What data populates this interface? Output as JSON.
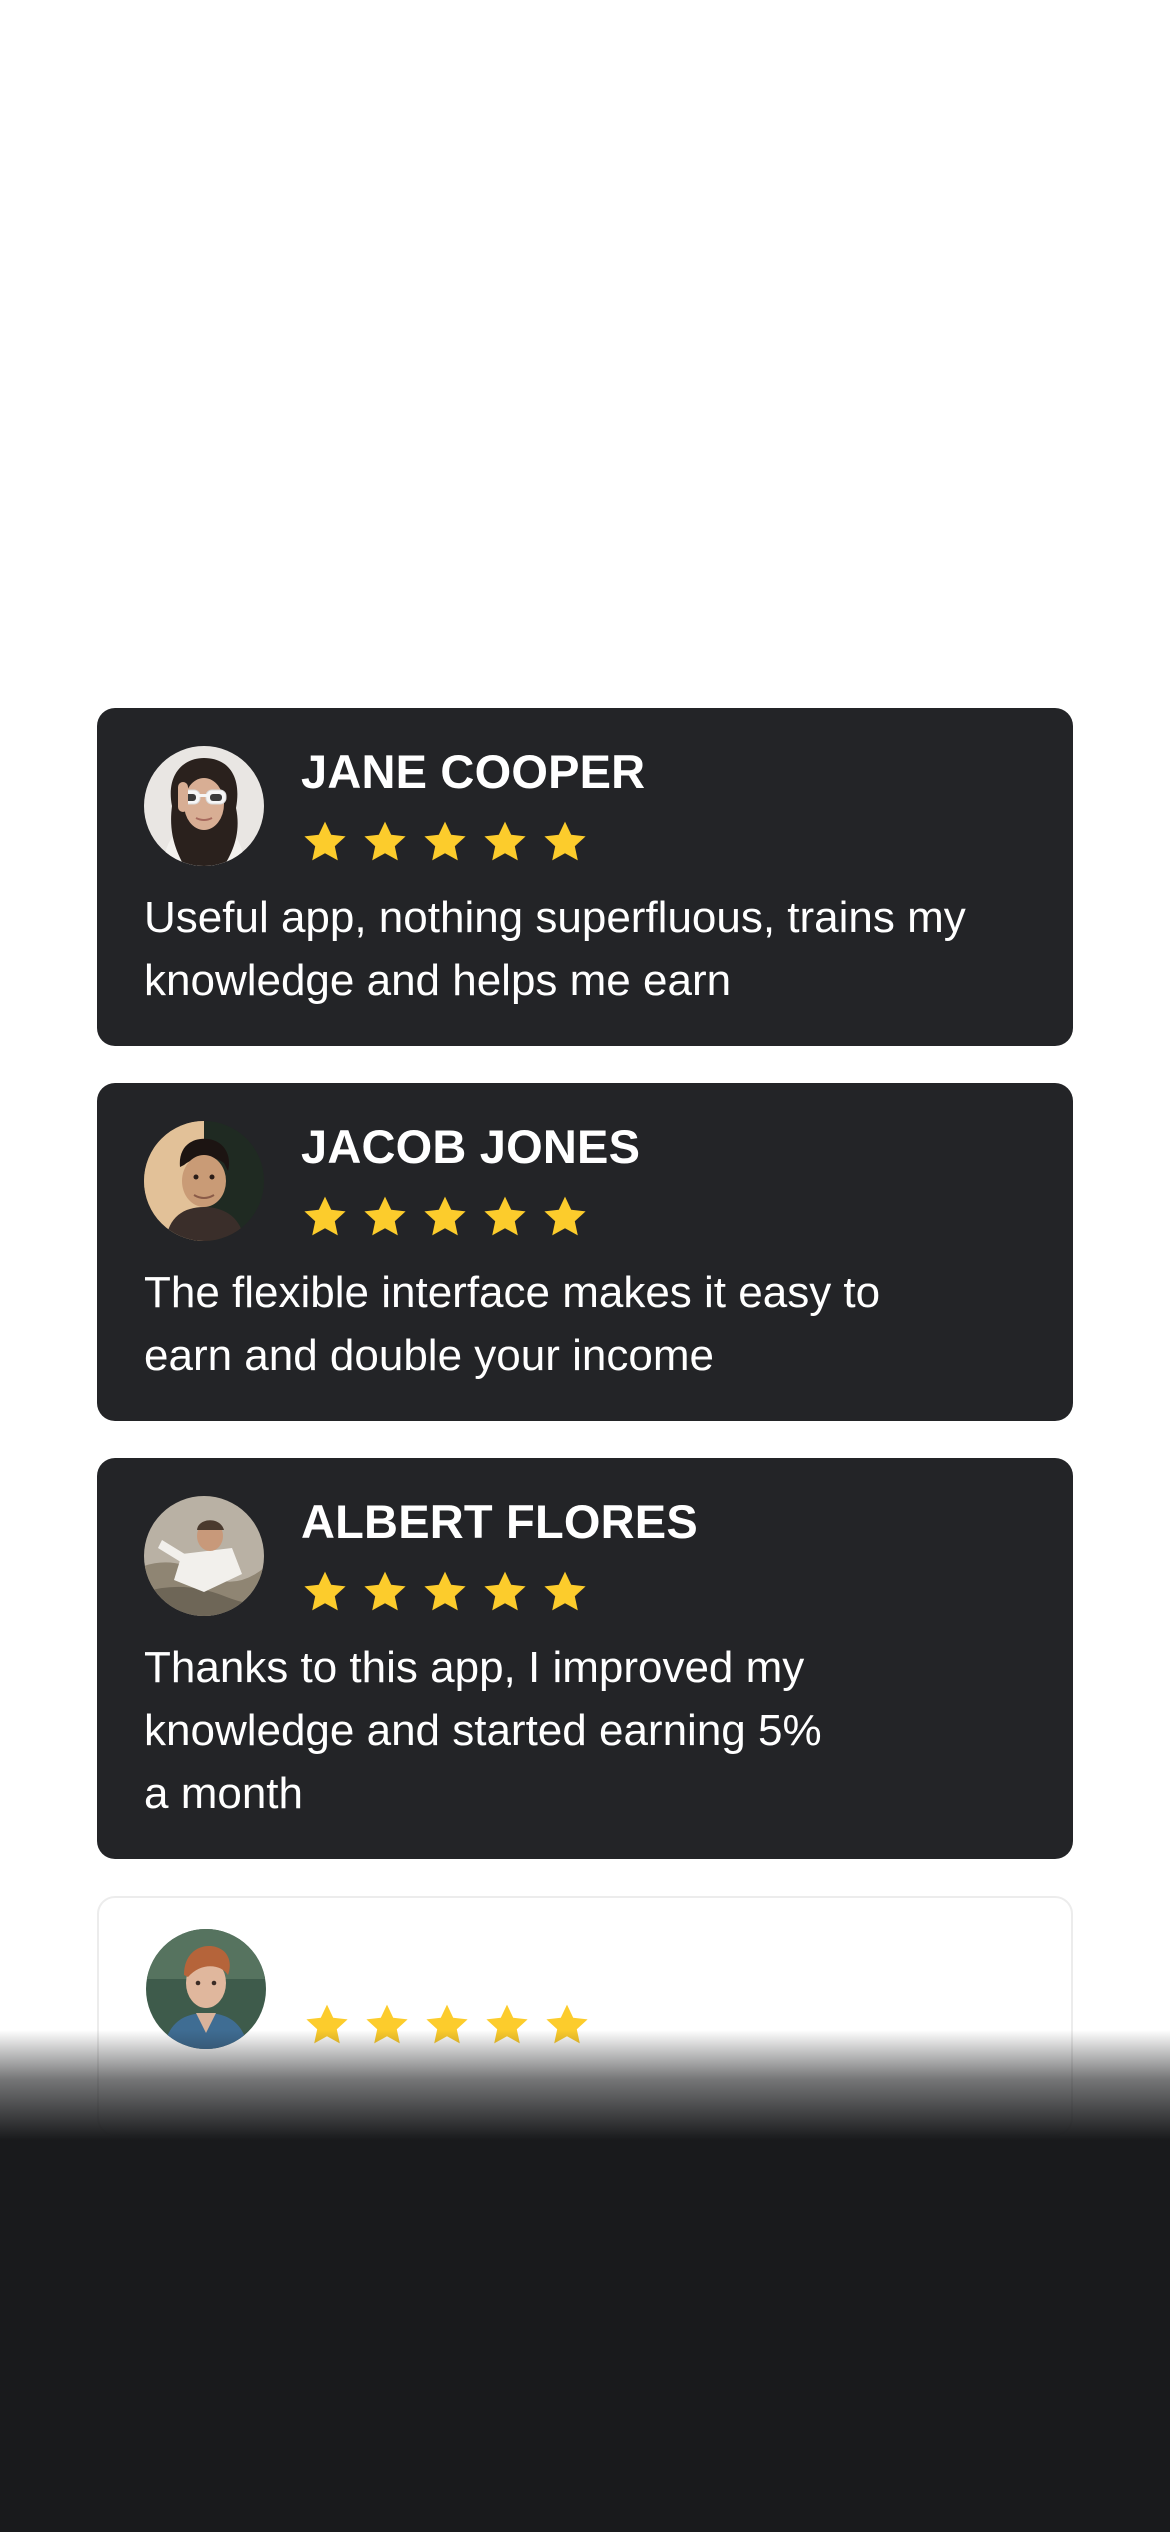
{
  "reviews": [
    {
      "name": "JANE COOPER",
      "rating": 5,
      "text_lines": [
        "Useful app, nothing superfluous, trains my",
        "knowledge and helps me earn"
      ],
      "avatar": "woman-white-sunglasses-photo"
    },
    {
      "name": "JACOB JONES",
      "rating": 5,
      "text_lines": [
        "The flexible interface makes it easy to",
        "earn and double your income"
      ],
      "avatar": "man-warm-light-photo"
    },
    {
      "name": "ALBERT FLORES",
      "rating": 5,
      "text_lines": [
        "Thanks to this app, I improved my",
        "knowledge and started earning 5%",
        "a month"
      ],
      "avatar": "man-white-shirt-rocks-photo"
    },
    {
      "name": "",
      "rating": 5,
      "text_lines": [],
      "avatar": "man-red-hair-denim-photo"
    }
  ],
  "colors": {
    "card_background": "#232427",
    "star": "#fccc2c",
    "bottom_panel": "#191a1c",
    "text": "#ffffff"
  },
  "icons": {
    "star": "star-icon"
  }
}
